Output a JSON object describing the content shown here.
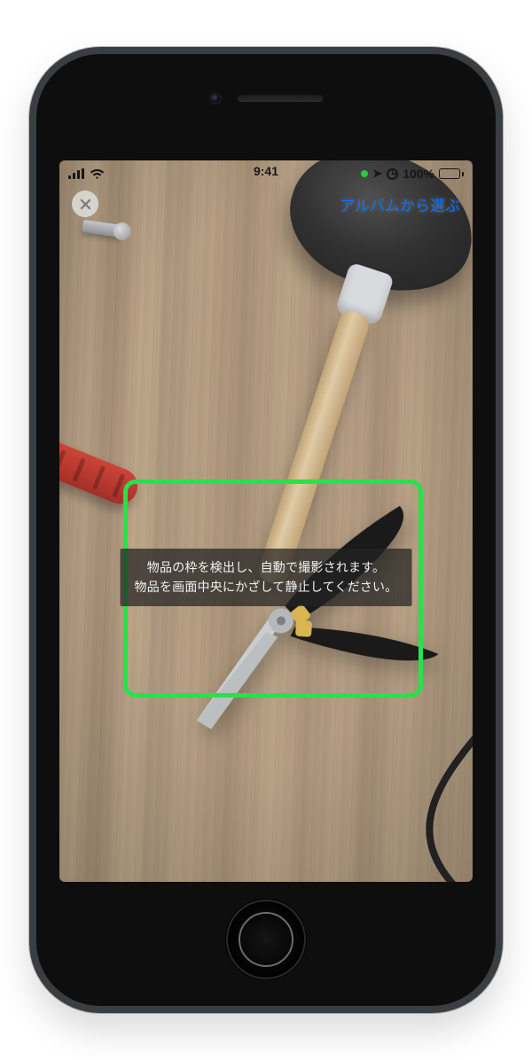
{
  "statusbar": {
    "time": "9:41",
    "battery_pct": "100%"
  },
  "navbar": {
    "album_link": "アルバムから選ぶ"
  },
  "instruction": {
    "line1": "物品の枠を検出し、自動で撮影されます。",
    "line2": "物品を画面中央にかざして静止してください。"
  },
  "colors": {
    "detection_frame": "#27e24a",
    "link": "#0a74ff"
  }
}
